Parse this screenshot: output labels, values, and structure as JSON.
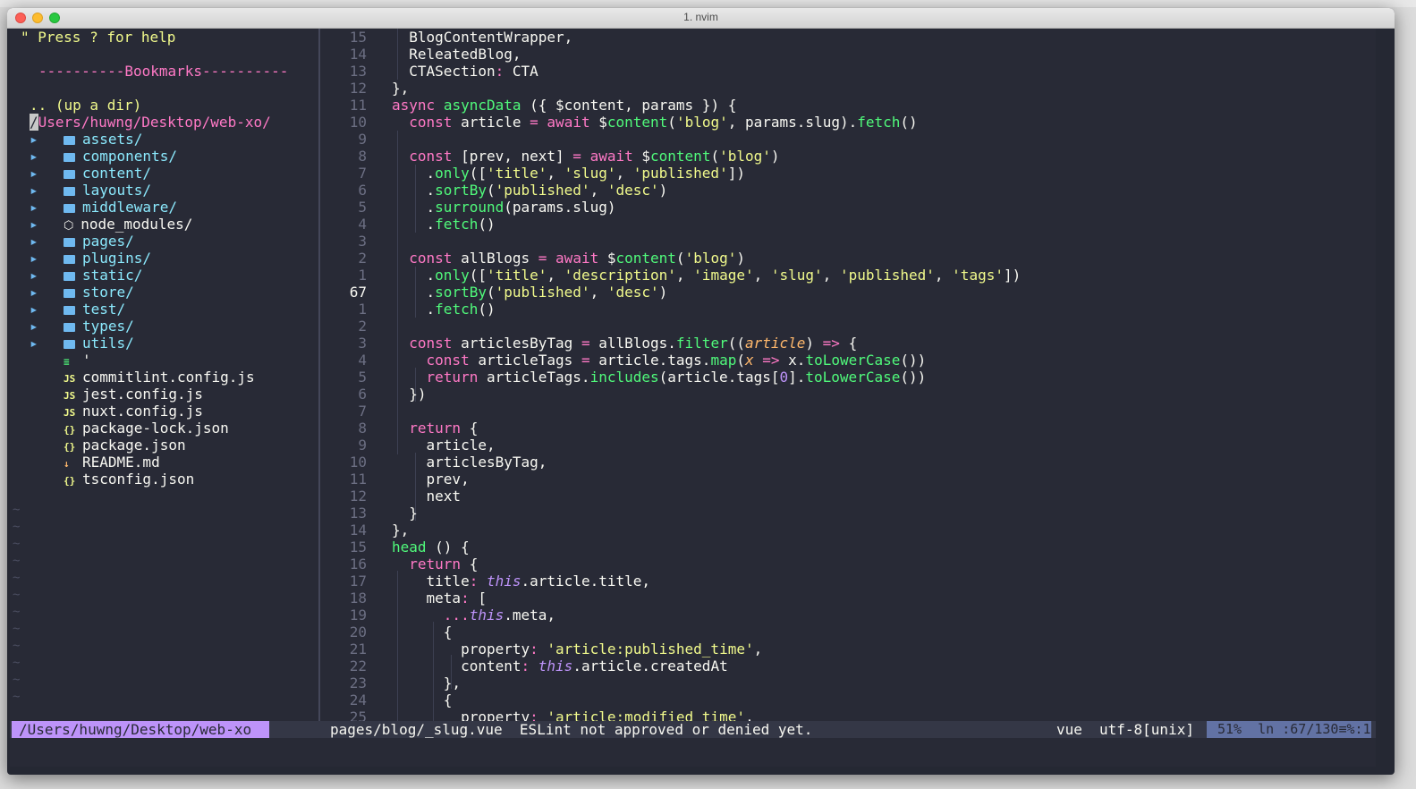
{
  "window": {
    "title": "1. nvim"
  },
  "tree": {
    "help": "\" Press ? for help",
    "bookmarks": "----------Bookmarks----------",
    "up_dir": ".. (up a dir)",
    "root": "/Users/huwng/Desktop/web-xo/",
    "folders": [
      "assets/",
      "components/",
      "content/",
      "layouts/",
      "middleware/",
      "node_modules/",
      "pages/",
      "plugins/",
      "static/",
      "store/",
      "test/",
      "types/",
      "utils/"
    ],
    "files": [
      {
        "icon": "≡",
        "name": "'"
      },
      {
        "icon": "JS",
        "name": "commitlint.config.js"
      },
      {
        "icon": "JS",
        "name": "jest.config.js"
      },
      {
        "icon": "JS",
        "name": "nuxt.config.js"
      },
      {
        "icon": "{}",
        "name": "package-lock.json"
      },
      {
        "icon": "{}",
        "name": "package.json"
      },
      {
        "icon": "↓",
        "name": "README.md"
      },
      {
        "icon": "{}",
        "name": "tsconfig.json"
      }
    ]
  },
  "editor": {
    "line_numbers": [
      "15",
      "14",
      "13",
      "12",
      "11",
      "10",
      "9",
      "8",
      "7",
      "6",
      "5",
      "4",
      "3",
      "2",
      "1",
      "67",
      "1",
      "2",
      "3",
      "4",
      "5",
      "6",
      "7",
      "8",
      "9",
      "10",
      "11",
      "12",
      "13",
      "14",
      "15",
      "16",
      "17",
      "18",
      "19",
      "20",
      "21",
      "22",
      "23",
      "24",
      "25"
    ],
    "current_line_index": 15
  },
  "statusline": {
    "path": "/Users/huwng/Desktop/web-xo",
    "file": "pages/blog/_slug.vue  ESLint not approved or denied yet.",
    "filetype": "vue",
    "encoding": "utf-8[unix]",
    "position": "51%  ln :67/130≡%:1"
  },
  "colors": {
    "background": "#282a36",
    "accent_purple": "#bd93f9",
    "pink": "#ff79c6",
    "green": "#50fa7b",
    "yellow": "#f1fa8c"
  }
}
